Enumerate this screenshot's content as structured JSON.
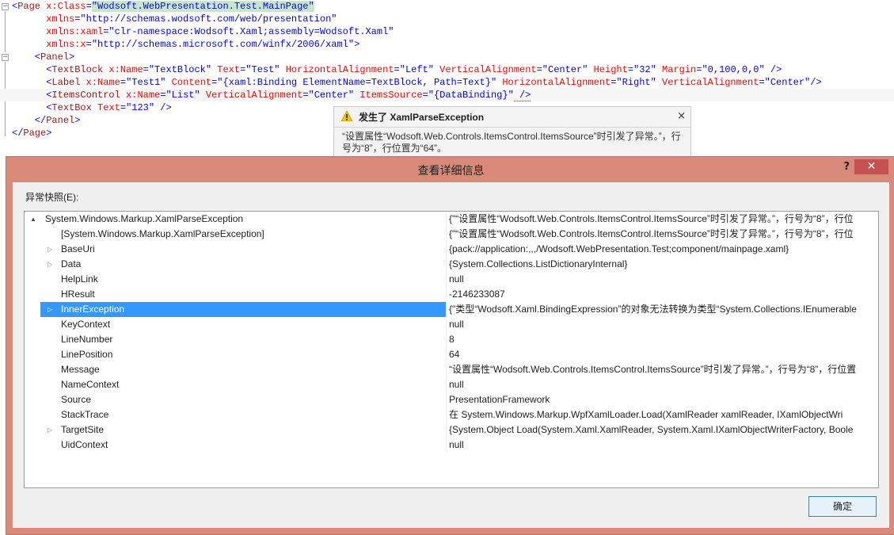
{
  "editor": {
    "lines": [
      {
        "tokens": [
          {
            "c": "p",
            "t": "<"
          },
          {
            "c": "t",
            "t": "Page"
          },
          {
            "c": "a",
            "t": " x:Class"
          },
          {
            "c": "p",
            "t": "="
          },
          {
            "c": "v",
            "t": "\"Wodsoft.WebPresentation.Test.MainPage\""
          }
        ]
      },
      {
        "tokens": [
          {
            "c": "a",
            "t": "      xmlns"
          },
          {
            "c": "p",
            "t": "="
          },
          {
            "c": "v",
            "t": "\"http://schemas.wodsoft.com/web/presentation\""
          }
        ]
      },
      {
        "tokens": [
          {
            "c": "a",
            "t": "      xmlns:xaml"
          },
          {
            "c": "p",
            "t": "="
          },
          {
            "c": "v",
            "t": "\"clr-namespace:Wodsoft.Xaml;assembly=Wodsoft.Xaml\""
          }
        ]
      },
      {
        "tokens": [
          {
            "c": "a",
            "t": "      xmlns:x"
          },
          {
            "c": "p",
            "t": "="
          },
          {
            "c": "v",
            "t": "\"http://schemas.microsoft.com/winfx/2006/xaml\""
          },
          {
            "c": "p",
            "t": ">"
          }
        ]
      },
      {
        "tokens": [
          {
            "c": "p",
            "t": "    <"
          },
          {
            "c": "t",
            "t": "Panel"
          },
          {
            "c": "p",
            "t": ">"
          }
        ]
      },
      {
        "tokens": [
          {
            "c": "p",
            "t": "      <"
          },
          {
            "c": "t",
            "t": "TextBlock"
          },
          {
            "c": "a",
            "t": " x:Name"
          },
          {
            "c": "p",
            "t": "="
          },
          {
            "c": "v",
            "t": "\"TextBlock\""
          },
          {
            "c": "a",
            "t": " Text"
          },
          {
            "c": "p",
            "t": "="
          },
          {
            "c": "v",
            "t": "\"Test\""
          },
          {
            "c": "a",
            "t": " HorizontalAlignment"
          },
          {
            "c": "p",
            "t": "="
          },
          {
            "c": "v",
            "t": "\"Left\""
          },
          {
            "c": "a",
            "t": " VerticalAlignment"
          },
          {
            "c": "p",
            "t": "="
          },
          {
            "c": "v",
            "t": "\"Center\""
          },
          {
            "c": "a",
            "t": " Height"
          },
          {
            "c": "p",
            "t": "="
          },
          {
            "c": "v",
            "t": "\"32\""
          },
          {
            "c": "a",
            "t": " Margin"
          },
          {
            "c": "p",
            "t": "="
          },
          {
            "c": "v",
            "t": "\"0,100,0,0\""
          },
          {
            "c": "p",
            "t": " />"
          }
        ]
      },
      {
        "tokens": [
          {
            "c": "p",
            "t": "      <"
          },
          {
            "c": "t",
            "t": "Label"
          },
          {
            "c": "a",
            "t": " x:Name"
          },
          {
            "c": "p",
            "t": "="
          },
          {
            "c": "v",
            "t": "\"Test1\""
          },
          {
            "c": "a",
            "t": " Content"
          },
          {
            "c": "p",
            "t": "="
          },
          {
            "c": "v",
            "t": "\"{xaml:Binding ElementName=TextBlock, Path=Text}\""
          },
          {
            "c": "a",
            "t": " HorizontalAlignment"
          },
          {
            "c": "p",
            "t": "="
          },
          {
            "c": "v",
            "t": "\"Right\""
          },
          {
            "c": "a",
            "t": " VerticalAlignment"
          },
          {
            "c": "p",
            "t": "="
          },
          {
            "c": "v",
            "t": "\"Center\""
          },
          {
            "c": "p",
            "t": "/>"
          }
        ]
      },
      {
        "tokens": [
          {
            "c": "p",
            "t": "      <"
          },
          {
            "c": "t",
            "t": "ItemsControl"
          },
          {
            "c": "a",
            "t": " x:Name"
          },
          {
            "c": "p",
            "t": "="
          },
          {
            "c": "v",
            "t": "\"List\""
          },
          {
            "c": "a",
            "t": " VerticalAlignment"
          },
          {
            "c": "p",
            "t": "="
          },
          {
            "c": "v",
            "t": "\"Center\""
          },
          {
            "c": "a",
            "t": " ItemsSource"
          },
          {
            "c": "p",
            "t": "="
          },
          {
            "c": "v",
            "t": "\"{DataBinding}\""
          },
          {
            "c": "p",
            "t": " />"
          }
        ]
      },
      {
        "tokens": [
          {
            "c": "p",
            "t": "      <"
          },
          {
            "c": "t",
            "t": "TextBox"
          },
          {
            "c": "a",
            "t": " Text"
          },
          {
            "c": "p",
            "t": "="
          },
          {
            "c": "v",
            "t": "\"123\""
          },
          {
            "c": "p",
            "t": " />"
          }
        ]
      },
      {
        "tokens": [
          {
            "c": "p",
            "t": "    </"
          },
          {
            "c": "t",
            "t": "Panel"
          },
          {
            "c": "p",
            "t": ">"
          }
        ]
      },
      {
        "tokens": [
          {
            "c": "p",
            "t": "</"
          },
          {
            "c": "t",
            "t": "Page"
          },
          {
            "c": "p",
            "t": ">"
          }
        ]
      }
    ]
  },
  "popup": {
    "title": "发生了 XamlParseException",
    "message": "“设置属性“Wodsoft.Web.Controls.ItemsControl.ItemsSource”时引发了异常。”，行号为“8”，行位置为“64”。",
    "close": "×",
    "warning_icon": "warning-icon"
  },
  "dialog": {
    "title": "查看详细信息",
    "help": "?",
    "close": "✕",
    "snapshot_label": "异常快照(E):",
    "ok": "确定",
    "rows": [
      {
        "name": "System.Windows.Markup.XamlParseException",
        "value": "{\"“设置属性“Wodsoft.Web.Controls.ItemsControl.ItemsSource”时引发了异常。”，行号为“8”，行位",
        "expander": "▲",
        "level": 0,
        "selected": false
      },
      {
        "name": "[System.Windows.Markup.XamlParseException]",
        "value": "{\"“设置属性“Wodsoft.Web.Controls.ItemsControl.ItemsSource”时引发了异常。”，行号为“8”，行位",
        "expander": "",
        "level": 1,
        "selected": false
      },
      {
        "name": "BaseUri",
        "value": "{pack://application:,,,/Wodsoft.WebPresentation.Test;component/mainpage.xaml}",
        "expander": "▷",
        "level": 1,
        "selected": false
      },
      {
        "name": "Data",
        "value": "{System.Collections.ListDictionaryInternal}",
        "expander": "▷",
        "level": 1,
        "selected": false
      },
      {
        "name": "HelpLink",
        "value": "null",
        "expander": "",
        "level": 1,
        "selected": false
      },
      {
        "name": "HResult",
        "value": "-2146233087",
        "expander": "",
        "level": 1,
        "selected": false
      },
      {
        "name": "InnerException",
        "value": "{\"类型“Wodsoft.Xaml.BindingExpression”的对象无法转换为类型“System.Collections.IEnumerable",
        "expander": "▷",
        "level": 1,
        "selected": true
      },
      {
        "name": "KeyContext",
        "value": "null",
        "expander": "",
        "level": 1,
        "selected": false
      },
      {
        "name": "LineNumber",
        "value": "8",
        "expander": "",
        "level": 1,
        "selected": false
      },
      {
        "name": "LinePosition",
        "value": "64",
        "expander": "",
        "level": 1,
        "selected": false
      },
      {
        "name": "Message",
        "value": "“设置属性“Wodsoft.Web.Controls.ItemsControl.ItemsSource”时引发了异常。”，行号为“8”，行位置",
        "expander": "",
        "level": 1,
        "selected": false
      },
      {
        "name": "NameContext",
        "value": "null",
        "expander": "",
        "level": 1,
        "selected": false
      },
      {
        "name": "Source",
        "value": "PresentationFramework",
        "expander": "",
        "level": 1,
        "selected": false
      },
      {
        "name": "StackTrace",
        "value": "  在 System.Windows.Markup.WpfXamlLoader.Load(XamlReader xamlReader, IXamlObjectWri",
        "expander": "",
        "level": 1,
        "selected": false
      },
      {
        "name": "TargetSite",
        "value": "{System.Object Load(System.Xaml.XamlReader, System.Xaml.IXamlObjectWriterFactory, Boole",
        "expander": "▷",
        "level": 1,
        "selected": false
      },
      {
        "name": "UidContext",
        "value": "null",
        "expander": "",
        "level": 1,
        "selected": false
      }
    ]
  },
  "colors": {
    "tag": "#a31515",
    "attr": "#ff0000",
    "value": "#0000ff",
    "selection": "#3399ff",
    "dialog_frame": "#d9897a"
  }
}
